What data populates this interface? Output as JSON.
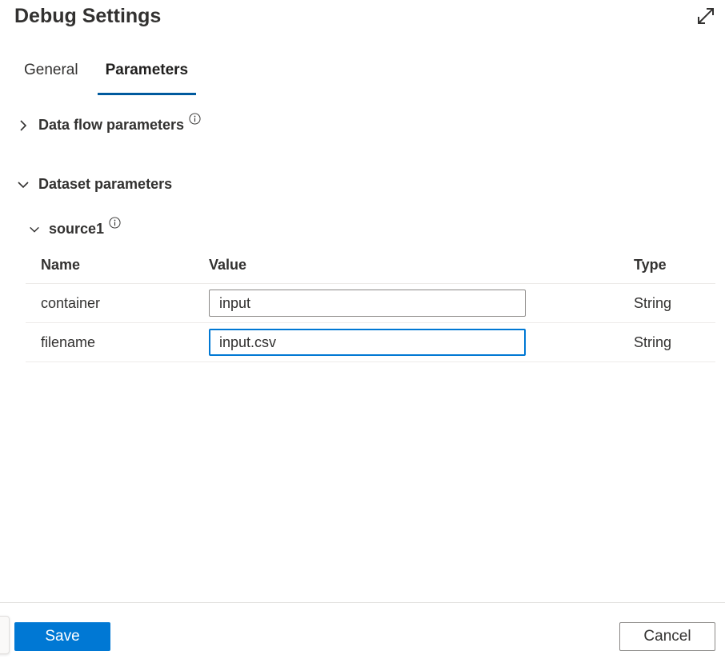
{
  "dialog": {
    "title": "Debug Settings",
    "expand_icon": "expand-diagonal-arrows-icon"
  },
  "tabs": [
    {
      "label": "General",
      "active": false
    },
    {
      "label": "Parameters",
      "active": true
    }
  ],
  "sections": {
    "data_flow": {
      "label": "Data flow parameters",
      "expanded": false,
      "icon": "chevron-right-icon",
      "info_icon": "info-icon"
    },
    "dataset": {
      "label": "Dataset parameters",
      "expanded": true,
      "icon": "chevron-down-icon"
    },
    "source": {
      "label": "source1",
      "expanded": true,
      "icon": "chevron-down-icon",
      "info_icon": "info-icon"
    }
  },
  "table": {
    "headers": {
      "name": "Name",
      "value": "Value",
      "type": "Type"
    },
    "rows": [
      {
        "name": "container",
        "value": "input",
        "type": "String"
      },
      {
        "name": "filename",
        "value": "input.csv",
        "type": "String"
      }
    ]
  },
  "footer": {
    "save_label": "Save",
    "cancel_label": "Cancel"
  },
  "colors": {
    "accent": "#0078d4",
    "tab_underline": "#005a9e"
  }
}
